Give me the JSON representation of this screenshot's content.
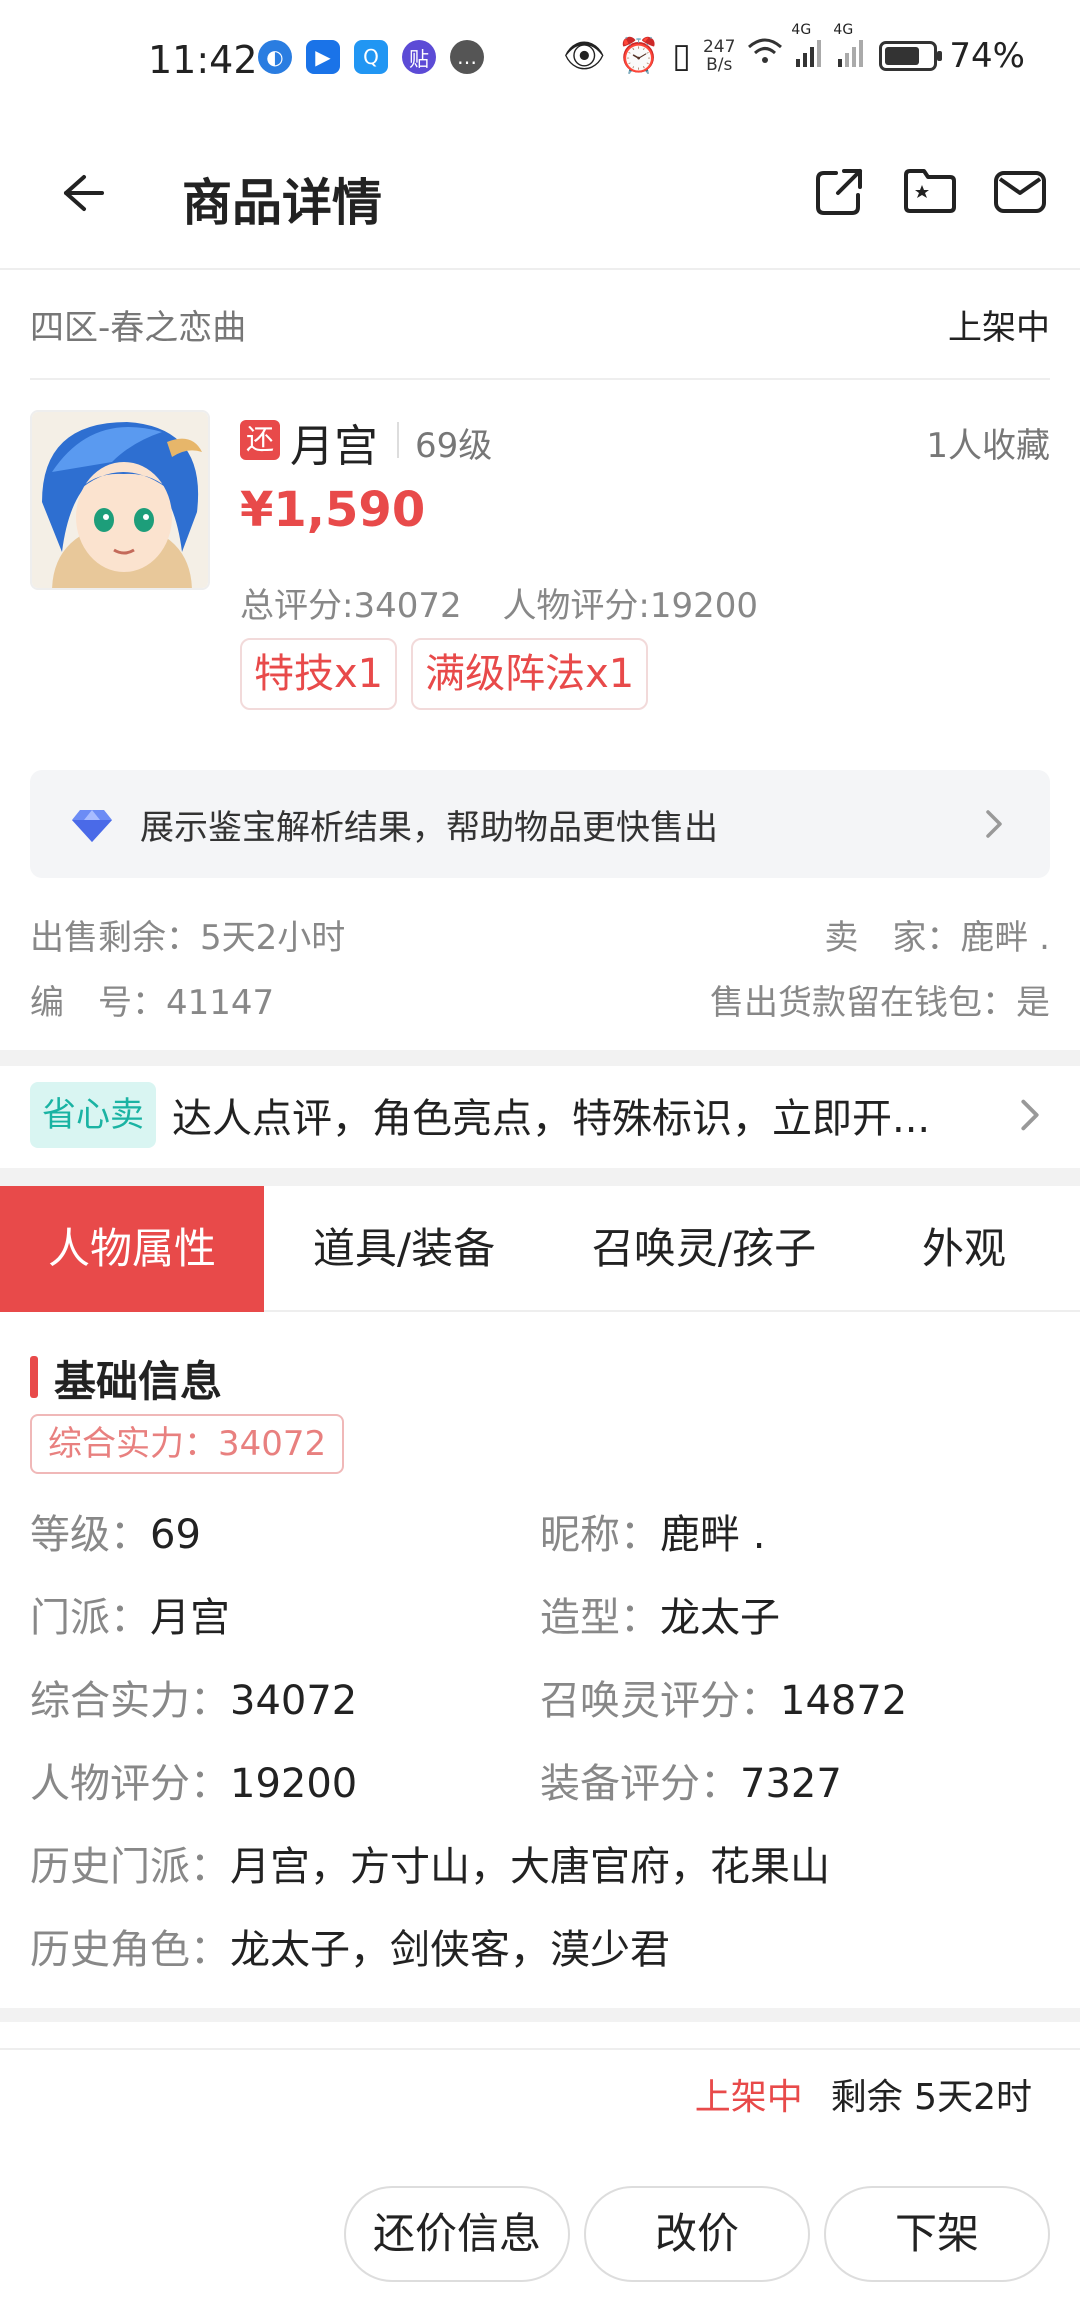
{
  "status_bar": {
    "time": "11:42",
    "net_speed_value": "247",
    "net_speed_unit": "B/s",
    "battery_percent": "74%",
    "battery_level": 0.74,
    "sig1": "4G",
    "sig2": "4G"
  },
  "header": {
    "title": "商品详情"
  },
  "server": {
    "name": "四区-春之恋曲",
    "status": "上架中"
  },
  "product": {
    "badge": "还",
    "name": "月宫",
    "level": "69级",
    "favorites": "1人收藏",
    "price": "¥1,590",
    "total_score": "总评分:34072",
    "char_score": "人物评分:19200",
    "tags": [
      "特技x1",
      "满级阵法x1"
    ]
  },
  "appraisal": {
    "text": "展示鉴宝解析结果，帮助物品更快售出"
  },
  "info": {
    "sale_remaining": "出售剩余：5天2小时",
    "seller": "卖　家：鹿畔 .",
    "serial": "编　号：41147",
    "wallet": "售出货款留在钱包：是"
  },
  "easy_sell": {
    "badge": "省心卖",
    "text": "达人点评，角色亮点，特殊标识，立即开..."
  },
  "tabs": [
    "人物属性",
    "道具/装备",
    "召唤灵/孩子",
    "外观"
  ],
  "basic_info": {
    "title": "基础信息",
    "strength_badge": "综合实力：34072",
    "rows": [
      {
        "k": "等级：",
        "v": "69"
      },
      {
        "k": "昵称：",
        "v": "鹿畔 ."
      },
      {
        "k": "门派：",
        "v": "月宫"
      },
      {
        "k": "造型：",
        "v": "龙太子"
      },
      {
        "k": "综合实力：",
        "v": "34072"
      },
      {
        "k": "召唤灵评分：",
        "v": "14872"
      },
      {
        "k": "人物评分：",
        "v": "19200"
      },
      {
        "k": "装备评分：",
        "v": "7327"
      },
      {
        "k": "历史门派：",
        "v": "月宫，方寸山，大唐官府，花果山"
      },
      {
        "k": "历史角色：",
        "v": "龙太子，剑侠客，漠少君"
      }
    ]
  },
  "bottom": {
    "status": "上架中",
    "remaining": "剩余 5天2时",
    "buttons": [
      "还价信息",
      "改价",
      "下架"
    ]
  },
  "colors": {
    "accent": "#e84a4a",
    "teal": "#1ab3a3"
  }
}
